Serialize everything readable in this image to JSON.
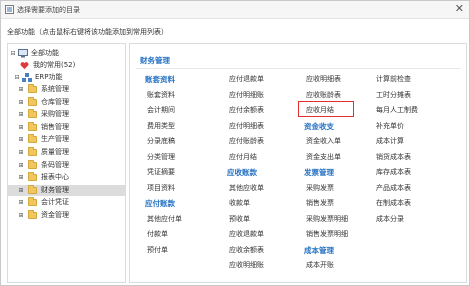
{
  "window": {
    "title": "选择需要添加的目录",
    "close_glyph": "✕"
  },
  "hint": "全部功能（点击鼠标右键将该功能添加到常用列表）",
  "tree": {
    "root": "全部功能",
    "favorites": "我的常用(52)",
    "erp": "ERP功能",
    "modules": [
      "系统管理",
      "仓库管理",
      "采购管理",
      "销售管理",
      "生产管理",
      "质量管理",
      "条码管理",
      "报表中心",
      "财务管理",
      "会计凭证",
      "资金管理"
    ],
    "selected": "财务管理"
  },
  "panel": {
    "title": "财务管理",
    "columns": [
      [
        {
          "t": "cat",
          "v": "账套资料"
        },
        {
          "t": "item",
          "v": "账套资料"
        },
        {
          "t": "item",
          "v": "会计期间"
        },
        {
          "t": "item",
          "v": "费用类型"
        },
        {
          "t": "item",
          "v": "分录底稿"
        },
        {
          "t": "item",
          "v": "分类管理"
        },
        {
          "t": "item",
          "v": "凭证摘要"
        },
        {
          "t": "item",
          "v": "项目资料"
        },
        {
          "t": "cat",
          "v": "应付账款"
        },
        {
          "t": "item",
          "v": "其他应付单"
        },
        {
          "t": "item",
          "v": "付款单"
        },
        {
          "t": "item",
          "v": "预付单"
        }
      ],
      [
        {
          "t": "item",
          "v": "应付退款单"
        },
        {
          "t": "item",
          "v": "应付明细账"
        },
        {
          "t": "item",
          "v": "应付余额表"
        },
        {
          "t": "item",
          "v": "应付明细表"
        },
        {
          "t": "item",
          "v": "应付账龄表"
        },
        {
          "t": "item",
          "v": "应付月结"
        },
        {
          "t": "cat",
          "v": "应收账款"
        },
        {
          "t": "item",
          "v": "其他应收单"
        },
        {
          "t": "item",
          "v": "收款单"
        },
        {
          "t": "item",
          "v": "预收单"
        },
        {
          "t": "item",
          "v": "应收退款单"
        },
        {
          "t": "item",
          "v": "应收余额表"
        },
        {
          "t": "item",
          "v": "应收明细账"
        }
      ],
      [
        {
          "t": "item",
          "v": "应收明细表"
        },
        {
          "t": "item",
          "v": "应收账龄表"
        },
        {
          "t": "item",
          "v": "应收月结"
        },
        {
          "t": "cat",
          "v": "资金收支"
        },
        {
          "t": "item",
          "v": "资金收入单"
        },
        {
          "t": "item",
          "v": "资金支出单"
        },
        {
          "t": "cat",
          "v": "发票管理"
        },
        {
          "t": "item",
          "v": "采购发票"
        },
        {
          "t": "item",
          "v": "销售发票"
        },
        {
          "t": "item",
          "v": "采购发票明细"
        },
        {
          "t": "item",
          "v": "销售发票明细"
        },
        {
          "t": "cat",
          "v": "成本管理"
        },
        {
          "t": "item",
          "v": "成本开账"
        }
      ],
      [
        {
          "t": "item",
          "v": "计算前检查"
        },
        {
          "t": "item",
          "v": "工时分摊表"
        },
        {
          "t": "item",
          "v": "每月人工制费"
        },
        {
          "t": "item",
          "v": "补充单价"
        },
        {
          "t": "item",
          "v": "成本计算"
        },
        {
          "t": "item",
          "v": "销货成本表"
        },
        {
          "t": "item",
          "v": "库存成本表"
        },
        {
          "t": "item",
          "v": "产品成本表"
        },
        {
          "t": "item",
          "v": "在制成本表"
        },
        {
          "t": "item",
          "v": "成本分录"
        }
      ]
    ]
  },
  "colors": {
    "accent": "#2672c3",
    "highlight": "#e0312f",
    "folder": "#f0c75e"
  }
}
